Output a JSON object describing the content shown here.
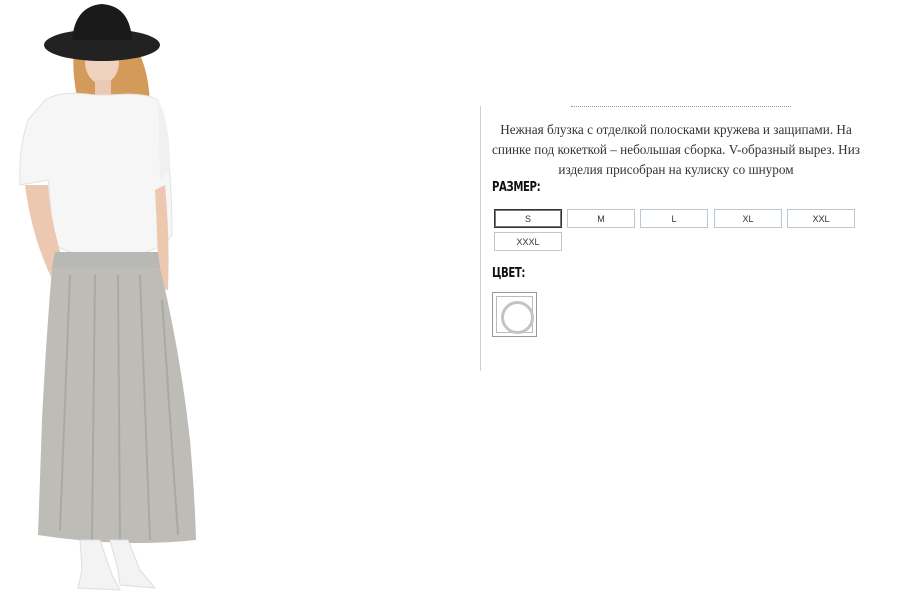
{
  "product": {
    "description": "Нежная блузка с отделкой полосками кружева и защипами. На спинке под кокеткой – небольшая сборка. V-образный вырез. Низ изделия присобран на кулиску со шнуром",
    "size_heading": "РАЗМЕР:",
    "color_heading": "ЦВЕТ:",
    "sizes": [
      "S",
      "M",
      "L",
      "XL",
      "XXL",
      "XXXL"
    ],
    "selected_size": "S",
    "colors": [
      {
        "name": "white",
        "hex": "#ffffff"
      }
    ]
  }
}
